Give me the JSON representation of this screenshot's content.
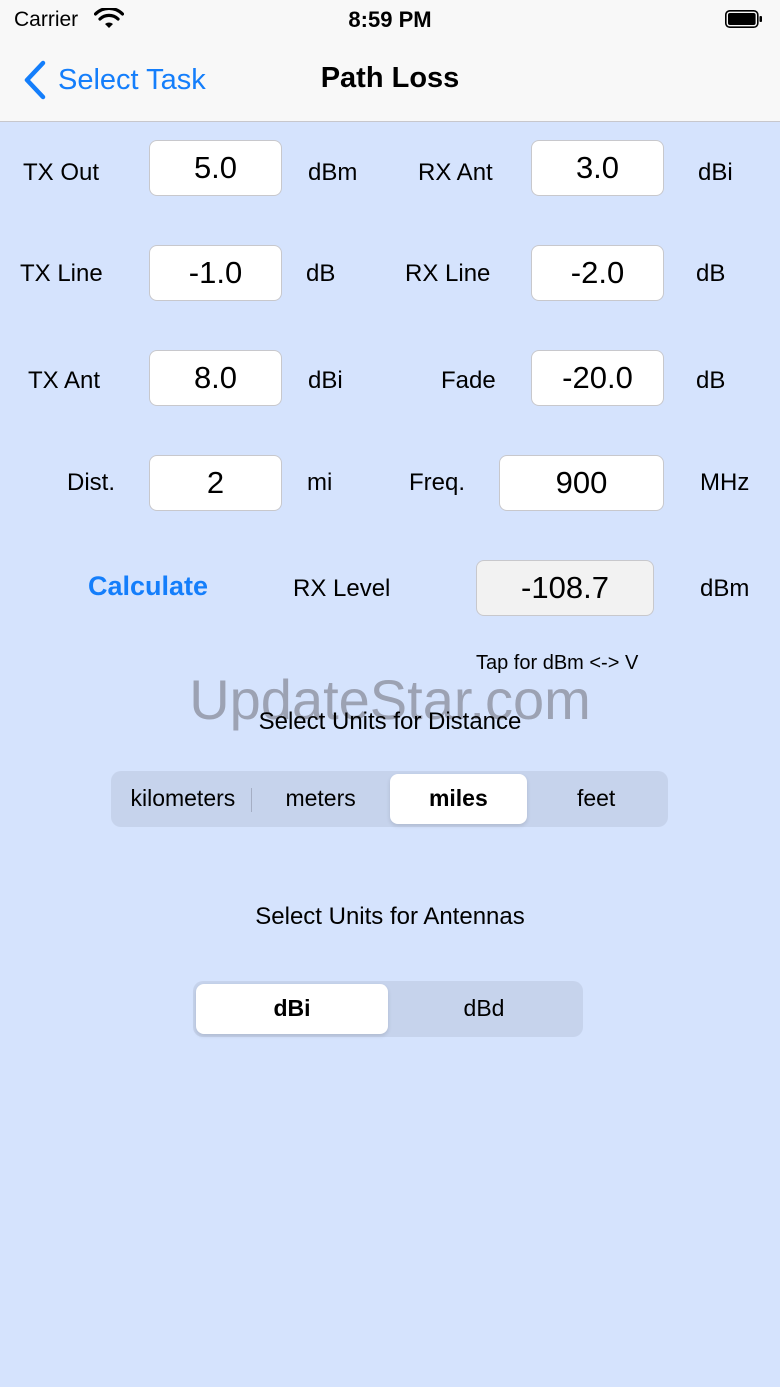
{
  "status_bar": {
    "carrier": "Carrier",
    "time": "8:59 PM"
  },
  "nav": {
    "back_label": "Select Task",
    "title": "Path Loss"
  },
  "form": {
    "tx_out": {
      "label": "TX Out",
      "value": "5.0",
      "unit": "dBm"
    },
    "rx_ant": {
      "label": "RX Ant",
      "value": "3.0",
      "unit": "dBi"
    },
    "tx_line": {
      "label": "TX Line",
      "value": "-1.0",
      "unit": "dB"
    },
    "rx_line": {
      "label": "RX Line",
      "value": "-2.0",
      "unit": "dB"
    },
    "tx_ant": {
      "label": "TX Ant",
      "value": "8.0",
      "unit": "dBi"
    },
    "fade": {
      "label": "Fade",
      "value": "-20.0",
      "unit": "dB"
    },
    "dist": {
      "label": "Dist.",
      "value": "2",
      "unit": "mi"
    },
    "freq": {
      "label": "Freq.",
      "value": "900",
      "unit": "MHz"
    }
  },
  "result": {
    "calculate_label": "Calculate",
    "rx_level_label": "RX Level",
    "rx_level_value": "-108.7",
    "rx_level_unit": "dBm",
    "hint": "Tap for dBm <-> V"
  },
  "watermark": "UpdateStar.com",
  "distance_units": {
    "title": "Select Units for Distance",
    "options": [
      "kilometers",
      "meters",
      "miles",
      "feet"
    ],
    "selected": "miles"
  },
  "antenna_units": {
    "title": "Select Units for Antennas",
    "options": [
      "dBi",
      "dBd"
    ],
    "selected": "dBi"
  },
  "colors": {
    "accent": "#147efb",
    "background": "#d5e3fd",
    "segment_bg": "#c6d3ec"
  },
  "icons": {
    "wifi": "wifi-icon",
    "battery": "battery-icon",
    "back": "chevron-left-icon"
  }
}
